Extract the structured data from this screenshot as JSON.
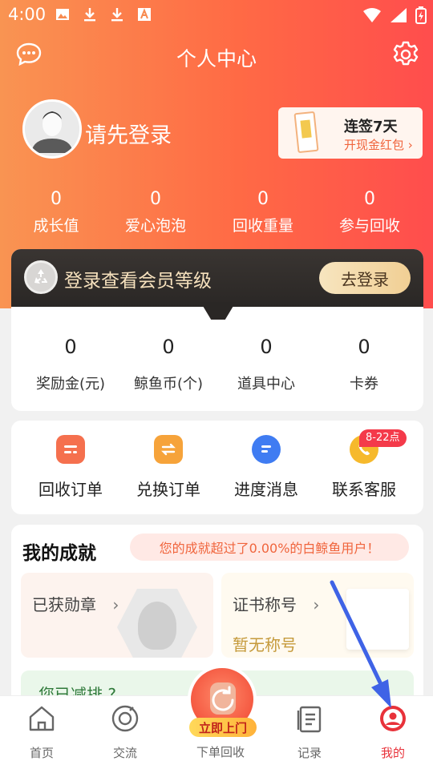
{
  "statusbar": {
    "time": "4:00"
  },
  "header": {
    "title": "个人中心"
  },
  "profile": {
    "login_prompt": "请先登录"
  },
  "signin": {
    "title": "连签7天",
    "subtitle": "开现金红包 ›"
  },
  "stats": [
    {
      "value": "0",
      "label": "成长值"
    },
    {
      "value": "0",
      "label": "爱心泡泡"
    },
    {
      "value": "0",
      "label": "回收重量"
    },
    {
      "value": "0",
      "label": "参与回收"
    }
  ],
  "member": {
    "text": "登录查看会员等级",
    "button": "去登录"
  },
  "wallet": [
    {
      "value": "0",
      "label": "奖励金(元)"
    },
    {
      "value": "0",
      "label": "鲸鱼币(个)"
    },
    {
      "value": "0",
      "label": "道具中心"
    },
    {
      "value": "0",
      "label": "卡券"
    }
  ],
  "orders": [
    {
      "label": "回收订单",
      "icon": "recycle-order-icon",
      "color": "#f5704e"
    },
    {
      "label": "兑换订单",
      "icon": "exchange-order-icon",
      "color": "#f6a33a"
    },
    {
      "label": "进度消息",
      "icon": "progress-message-icon",
      "color": "#3f7cf2"
    },
    {
      "label": "联系客服",
      "icon": "customer-service-icon",
      "color": "#f6b92c"
    }
  ],
  "service_hours": "8-22点",
  "achievements": {
    "title": "我的成就",
    "notice": "您的成就超过了0.00%的白鲸鱼用户！",
    "medals_label": "已获勋章",
    "medals_arrow": "›",
    "cert_label": "证书称号",
    "cert_arrow": "›",
    "cert_value": "暂无称号",
    "carbon_label": "您已减排 ?"
  },
  "nav": {
    "home": "首页",
    "community": "交流",
    "order": "下单回收",
    "order_tag": "立即上门",
    "records": "记录",
    "mine": "我的"
  },
  "colors": {
    "accent": "#ff5a4a",
    "active_tab": "#e8323a",
    "annotation_arrow": "#3f63e6"
  }
}
